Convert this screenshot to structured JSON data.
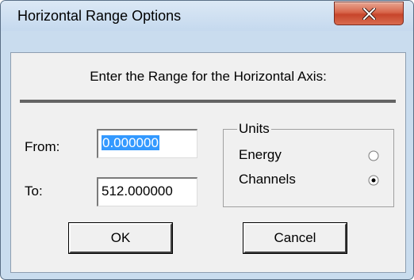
{
  "window": {
    "title": "Horizontal Range Options"
  },
  "dialog": {
    "prompt": "Enter the Range for the Horizontal Axis:",
    "from_label": "From:",
    "from_value": "0.000000",
    "to_label": "To:",
    "to_value": "512.000000",
    "units": {
      "title": "Units",
      "options": [
        {
          "label": "Energy",
          "selected": false
        },
        {
          "label": "Channels",
          "selected": true
        }
      ]
    },
    "ok_label": "OK",
    "cancel_label": "Cancel"
  },
  "icons": {
    "close": "close-icon"
  },
  "colors": {
    "close_button": "#c7452b",
    "selection": "#3399ff",
    "frame": "#c9dcee"
  }
}
